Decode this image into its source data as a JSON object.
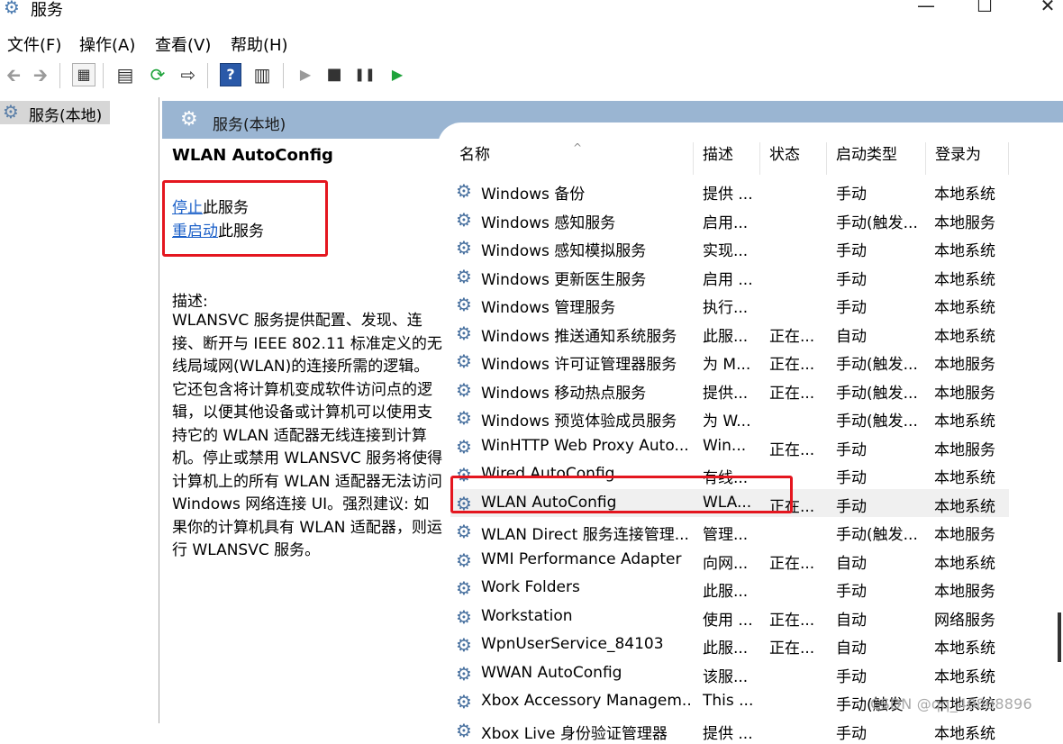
{
  "window": {
    "title": "服务",
    "minimize": "—",
    "maximize": "☐",
    "close": "✕"
  },
  "menu": [
    "文件(F)",
    "操作(A)",
    "查看(V)",
    "帮助(H)"
  ],
  "toolbar": {
    "back": "🡰",
    "forward": "🡲",
    "help": "?",
    "play": "▶",
    "stop": "■",
    "pause": "❚❚",
    "resume": "▶"
  },
  "tree": {
    "item": "服务(本地)"
  },
  "header": {
    "label": "服务(本地)"
  },
  "details": {
    "title": "WLAN AutoConfig",
    "stop_link": "停止",
    "stop_suffix": "此服务",
    "restart_link": "重启动",
    "restart_suffix": "此服务",
    "desc_label": "描述:",
    "desc_text": "WLANSVC 服务提供配置、发现、连接、断开与 IEEE 802.11 标准定义的无线局域网(WLAN)的连接所需的逻辑。它还包含将计算机变成软件访问点的逻辑，以便其他设备或计算机可以使用支持它的 WLAN 适配器无线连接到计算机。停止或禁用 WLANSVC 服务将使得计算机上的所有 WLAN 适配器无法访问 Windows 网络连接 UI。强烈建议: 如果你的计算机具有 WLAN 适配器，则运行 WLANSVC 服务。"
  },
  "columns": {
    "name": "名称",
    "desc": "描述",
    "status": "状态",
    "start": "启动类型",
    "logon": "登录为",
    "sort": "^"
  },
  "services": [
    {
      "name": "Windows 备份",
      "desc": "提供 ...",
      "status": "",
      "start": "手动",
      "logon": "本地系统"
    },
    {
      "name": "Windows 感知服务",
      "desc": "启用...",
      "status": "",
      "start": "手动(触发...",
      "logon": "本地服务"
    },
    {
      "name": "Windows 感知模拟服务",
      "desc": "实现...",
      "status": "",
      "start": "手动",
      "logon": "本地系统"
    },
    {
      "name": "Windows 更新医生服务",
      "desc": "启用 ...",
      "status": "",
      "start": "手动",
      "logon": "本地系统"
    },
    {
      "name": "Windows 管理服务",
      "desc": "执行...",
      "status": "",
      "start": "手动",
      "logon": "本地系统"
    },
    {
      "name": "Windows 推送通知系统服务",
      "desc": "此服...",
      "status": "正在...",
      "start": "自动",
      "logon": "本地系统"
    },
    {
      "name": "Windows 许可证管理器服务",
      "desc": "为 M...",
      "status": "正在...",
      "start": "手动(触发...",
      "logon": "本地服务"
    },
    {
      "name": "Windows 移动热点服务",
      "desc": "提供...",
      "status": "正在...",
      "start": "手动(触发...",
      "logon": "本地服务"
    },
    {
      "name": "Windows 预览体验成员服务",
      "desc": "为 W...",
      "status": "",
      "start": "手动(触发...",
      "logon": "本地系统"
    },
    {
      "name": "WinHTTP Web Proxy Auto...",
      "desc": "Win...",
      "status": "正在...",
      "start": "手动",
      "logon": "本地服务"
    },
    {
      "name": "Wired AutoConfig",
      "desc": "有线...",
      "status": "",
      "start": "手动",
      "logon": "本地系统"
    },
    {
      "name": "WLAN AutoConfig",
      "desc": "WLA...",
      "status": "正在...",
      "start": "手动",
      "logon": "本地系统"
    },
    {
      "name": "WLAN Direct 服务连接管理...",
      "desc": "管理...",
      "status": "",
      "start": "手动(触发...",
      "logon": "本地服务"
    },
    {
      "name": "WMI Performance Adapter",
      "desc": "向网...",
      "status": "正在...",
      "start": "自动",
      "logon": "本地系统"
    },
    {
      "name": "Work Folders",
      "desc": "此服...",
      "status": "",
      "start": "手动",
      "logon": "本地服务"
    },
    {
      "name": "Workstation",
      "desc": "使用 ...",
      "status": "正在...",
      "start": "自动",
      "logon": "网络服务"
    },
    {
      "name": "WpnUserService_84103",
      "desc": "此服...",
      "status": "正在...",
      "start": "自动",
      "logon": "本地系统"
    },
    {
      "name": "WWAN AutoConfig",
      "desc": "该服...",
      "status": "",
      "start": "手动",
      "logon": "本地系统"
    },
    {
      "name": "Xbox Accessory Managem...",
      "desc": "This ...",
      "status": "",
      "start": "手动(触发",
      "logon": "本地系统"
    },
    {
      "name": "Xbox Live 身份验证管理器",
      "desc": "提供 ...",
      "status": "",
      "start": "手动",
      "logon": "本地系统"
    }
  ],
  "selected_service": "WLAN AutoConfig",
  "watermark": "CSDN @qq_40808896",
  "colors": {
    "header_bar": "#9ab5d2",
    "link": "#1a5fc8",
    "highlight_box": "#e4161f",
    "selected_row": "#f0f0f0"
  }
}
